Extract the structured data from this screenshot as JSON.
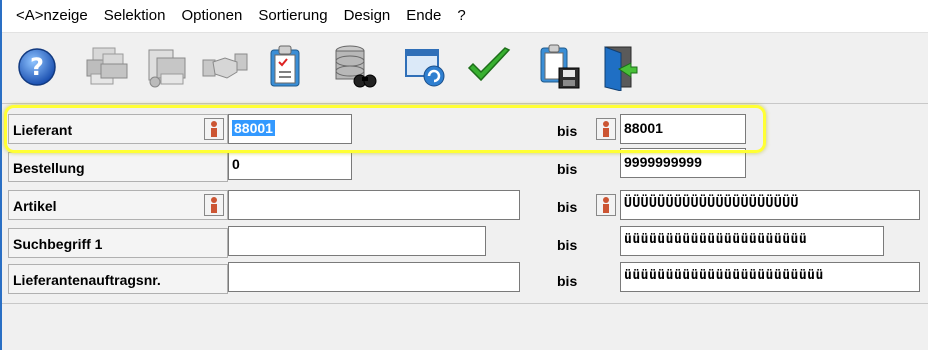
{
  "menu": {
    "items": [
      {
        "label": "<A>nzeige"
      },
      {
        "label": "Selektion"
      },
      {
        "label": "Optionen"
      },
      {
        "label": "Sortierung"
      },
      {
        "label": "Design"
      },
      {
        "label": "Ende"
      },
      {
        "label": "?"
      }
    ]
  },
  "toolbar": {
    "buttons": [
      {
        "icon": "help-icon"
      },
      {
        "icon": "printers-icon"
      },
      {
        "icon": "print-preview-icon"
      },
      {
        "icon": "handshake-icon"
      },
      {
        "icon": "clipboard-icon"
      },
      {
        "icon": "database-search-icon"
      },
      {
        "icon": "window-refresh-icon"
      },
      {
        "icon": "checkmark-icon"
      },
      {
        "icon": "clipboard-save-icon"
      },
      {
        "icon": "exit-door-icon"
      }
    ]
  },
  "form": {
    "rows": [
      {
        "label": "Lieferant",
        "from": "88001",
        "bis_label": "bis",
        "to": "88001"
      },
      {
        "label": "Bestellung",
        "from": "0",
        "bis_label": "bis",
        "to": "9999999999"
      },
      {
        "label": "Artikel",
        "from": "",
        "bis_label": "bis",
        "to": "ÜÜÜÜÜÜÜÜÜÜÜÜÜÜÜÜÜÜÜÜÜ"
      },
      {
        "label": "Suchbegriff 1",
        "from": "",
        "bis_label": "bis",
        "to": "üüüüüüüüüüüüüüüüüüüüüü"
      },
      {
        "label": "Lieferantenauftragsnr.",
        "from": "",
        "bis_label": "bis",
        "to": "üüüüüüüüüüüüüüüüüüüüüüüü"
      }
    ]
  },
  "colors": {
    "highlight": "#ffff33",
    "selection": "#3399ff",
    "window_border": "#2a6fc4"
  }
}
